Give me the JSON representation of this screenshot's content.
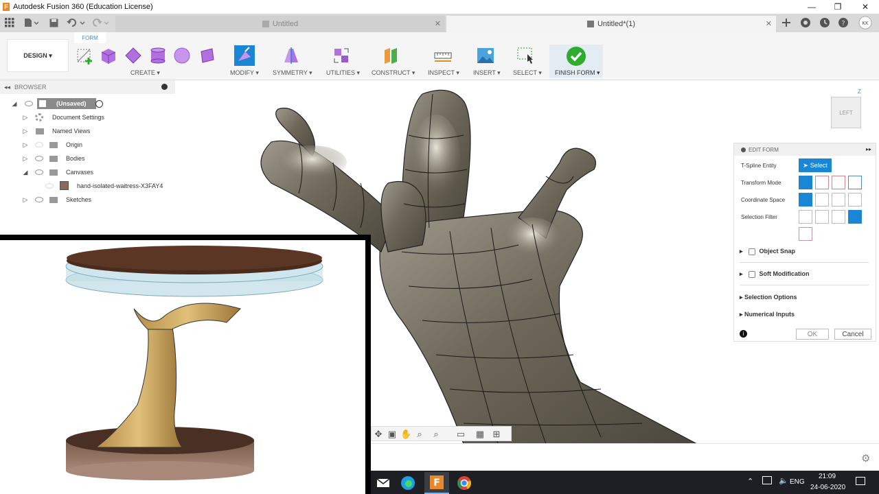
{
  "app": {
    "window_title": "Autodesk Fusion 360 (Education License)",
    "logo_letter": "F",
    "minimize": "—",
    "restore": "❐",
    "close": "✕"
  },
  "tabs": [
    {
      "label": "Untitled",
      "active": false
    },
    {
      "label": "Untitled*(1)",
      "active": true
    }
  ],
  "toolbar": {
    "workspace": "DESIGN ▾",
    "active_tab": "FORM",
    "groups": [
      {
        "label": "CREATE ▾"
      },
      {
        "label": "MODIFY ▾"
      },
      {
        "label": "SYMMETRY ▾"
      },
      {
        "label": "UTILITIES ▾"
      },
      {
        "label": "CONSTRUCT ▾"
      },
      {
        "label": "INSPECT ▾"
      },
      {
        "label": "INSERT ▾"
      },
      {
        "label": "SELECT ▾"
      },
      {
        "label": "FINISH FORM ▾"
      }
    ]
  },
  "browser": {
    "title": "BROWSER",
    "items": [
      {
        "label": "(Unsaved)"
      },
      {
        "label": "Document Settings"
      },
      {
        "label": "Named Views"
      },
      {
        "label": "Origin"
      },
      {
        "label": "Bodies"
      },
      {
        "label": "Canvases"
      },
      {
        "label": "hand-isolated-waitress-X3FAY4"
      },
      {
        "label": "Sketches"
      }
    ]
  },
  "viewcube": {
    "face": "LEFT",
    "axis": "Z"
  },
  "edit_form": {
    "title": "EDIT FORM",
    "rows": [
      {
        "label": "T-Spline Entity"
      },
      {
        "label": "Transform Mode"
      },
      {
        "label": "Coordinate Space"
      },
      {
        "label": "Selection Filter"
      }
    ],
    "select_button": "Select",
    "object_snap": "Object Snap",
    "soft_modification": "Soft Modification",
    "selection_options": "Selection Options",
    "numerical_inputs": "Numerical Inputs",
    "ok": "OK",
    "cancel": "Cancel"
  },
  "taskbar": {
    "time": "21:09",
    "date": "24-06-2020",
    "language": "ENG"
  }
}
